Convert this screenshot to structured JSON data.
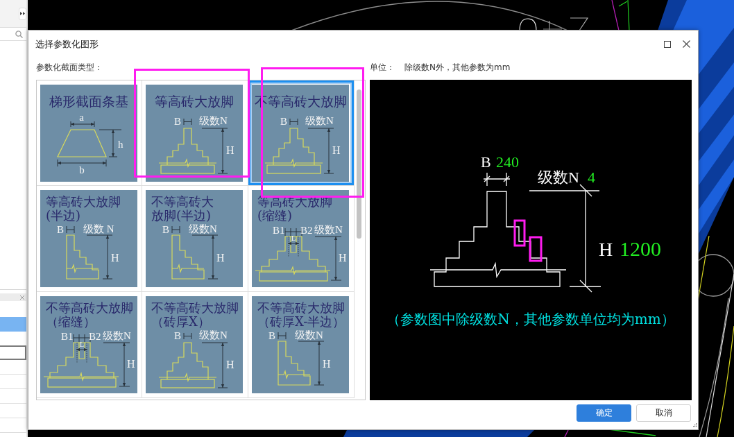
{
  "side_panel": {
    "rows": [
      {
        "kind": "row",
        "selected": true
      },
      {
        "kind": "field"
      },
      {
        "kind": "row",
        "selected": false
      },
      {
        "kind": "row",
        "selected": false
      },
      {
        "kind": "row",
        "selected": false
      },
      {
        "kind": "row",
        "selected": false
      },
      {
        "kind": "row",
        "selected": false
      }
    ]
  },
  "dialog": {
    "title": "选择参数化图形",
    "section_label": "参数化截面类型：",
    "unit_label": "单位：",
    "unit_text": "除级数N外，其他参数为mm"
  },
  "section_types": [
    {
      "kind": "trapezoid",
      "title": [
        "梯形截面条基"
      ],
      "labels": [
        "a",
        "h",
        "b"
      ],
      "selected": false,
      "highlighted": false
    },
    {
      "kind": "equal-steps",
      "title": [
        "等高砖大放脚"
      ],
      "labels": [
        "B",
        "级数N",
        "H"
      ],
      "selected": false,
      "highlighted": true
    },
    {
      "kind": "unequal-steps",
      "title": [
        "不等高砖大放脚"
      ],
      "labels": [
        "B",
        "级数N",
        "H"
      ],
      "selected": true,
      "highlighted": true
    },
    {
      "kind": "half",
      "title": [
        "等高砖大放脚",
        "(半边)"
      ],
      "labels": [
        "B",
        "级数 N",
        "H"
      ],
      "selected": false,
      "highlighted": false
    },
    {
      "kind": "half",
      "title": [
        "不等高砖大",
        "放脚(半边)"
      ],
      "labels": [
        "B",
        "级数N",
        "H"
      ],
      "selected": false,
      "highlighted": false
    },
    {
      "kind": "joint",
      "title": [
        "等高砖大放脚",
        "(缩缝)"
      ],
      "labels": [
        "B1",
        "B2",
        "级数N",
        "L",
        "H"
      ],
      "selected": false,
      "highlighted": false
    },
    {
      "kind": "joint",
      "title": [
        "不等高砖大放脚",
        "（缩缝）"
      ],
      "labels": [
        "B1",
        "B2",
        "级数N",
        "L",
        "H"
      ],
      "selected": false,
      "highlighted": false
    },
    {
      "kind": "unequal-steps",
      "title": [
        "不等高砖大放脚",
        "（砖厚X）"
      ],
      "labels": [
        "B",
        "级数N",
        "H"
      ],
      "selected": false,
      "highlighted": false
    },
    {
      "kind": "half",
      "title": [
        "不等高砖大放脚",
        "（砖厚X-半边）"
      ],
      "labels": [
        "B",
        "级数N",
        "H"
      ],
      "selected": false,
      "highlighted": false
    }
  ],
  "preview": {
    "params": [
      {
        "label": "B",
        "value": "240"
      },
      {
        "label": "级数N",
        "value": "4"
      },
      {
        "label": "H",
        "value": "1200"
      }
    ],
    "note": "（参数图中除级数N，其他参数单位均为mm）",
    "highlighted": true
  },
  "buttons": [
    {
      "label": "确定",
      "kind": "primary"
    },
    {
      "label": "取消",
      "kind": "secondary"
    }
  ]
}
